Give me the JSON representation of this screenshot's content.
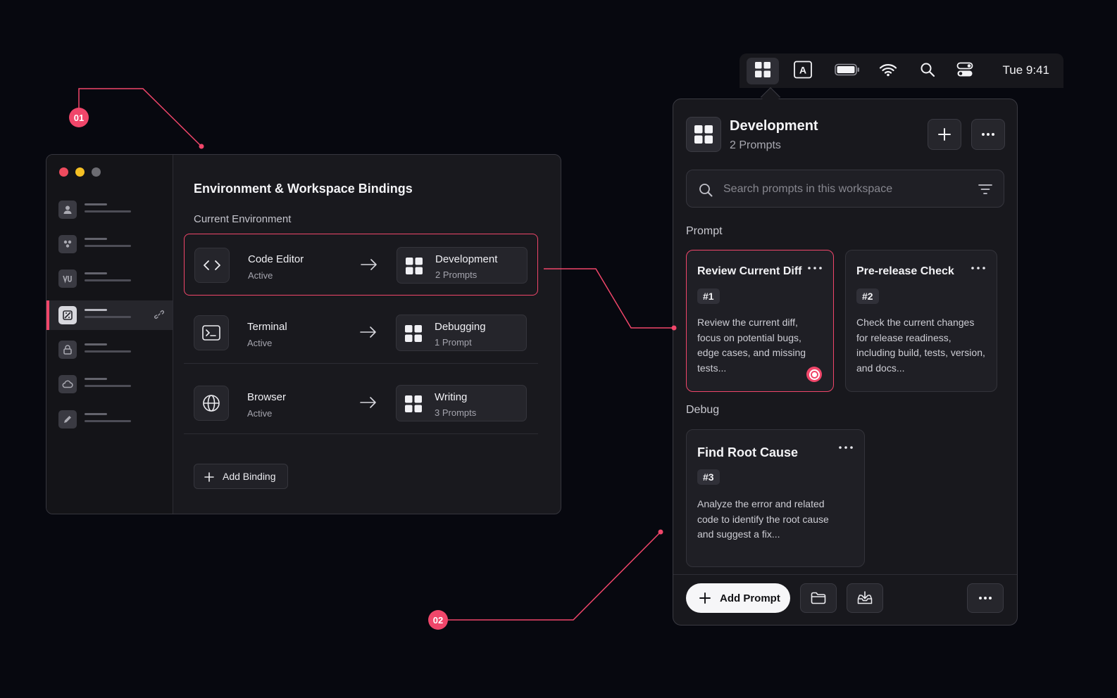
{
  "steps": [
    "01",
    "02"
  ],
  "left_window": {
    "title": "Environment & Workspace Bindings",
    "section_label": "Current Environment",
    "sidebar_icons": [
      "user-icon",
      "team-icon",
      "vu-icon",
      "binding-icon",
      "lock-icon",
      "cloud-icon",
      "pen-icon"
    ],
    "bindings": [
      {
        "app": "Code Editor",
        "status": "Active",
        "app_icon": "code-icon",
        "workspace": "Development",
        "prompts": "2 Prompts"
      },
      {
        "app": "Terminal",
        "status": "Active",
        "app_icon": "terminal-icon",
        "workspace": "Debugging",
        "prompts": "1 Prompt"
      },
      {
        "app": "Browser",
        "status": "Active",
        "app_icon": "globe-icon",
        "workspace": "Writing",
        "prompts": "3 Prompts"
      }
    ],
    "add_binding_label": "Add Binding"
  },
  "menubar": {
    "icons": [
      "workspace-grid-icon",
      "keyboard-input-icon",
      "battery-icon",
      "wifi-icon",
      "search-icon",
      "control-center-icon"
    ],
    "clock": "Tue 9:41"
  },
  "panel": {
    "workspace_title": "Development",
    "workspace_count": "2 Prompts",
    "search_placeholder": "Search prompts in this workspace",
    "groups": [
      {
        "label": "Prompt",
        "cards": [
          {
            "title": "Review Current Diff",
            "tag": "#1",
            "desc": "Review the current diff, focus on potential bugs, edge cases, and missing tests...",
            "selected": true
          },
          {
            "title": "Pre-release Check",
            "tag": "#2",
            "desc": "Check the current changes for release readiness, including build, tests, version, and docs...",
            "selected": false
          }
        ]
      },
      {
        "label": "Debug",
        "cards": [
          {
            "title": "Find Root Cause",
            "tag": "#3",
            "desc": "Analyze the error and related code to identify the root cause and suggest a fix...",
            "selected": false
          }
        ]
      }
    ],
    "add_prompt_label": "Add Prompt"
  },
  "colors": {
    "accent": "#f0466a",
    "background": "#07080f",
    "surface": "#18181d"
  }
}
